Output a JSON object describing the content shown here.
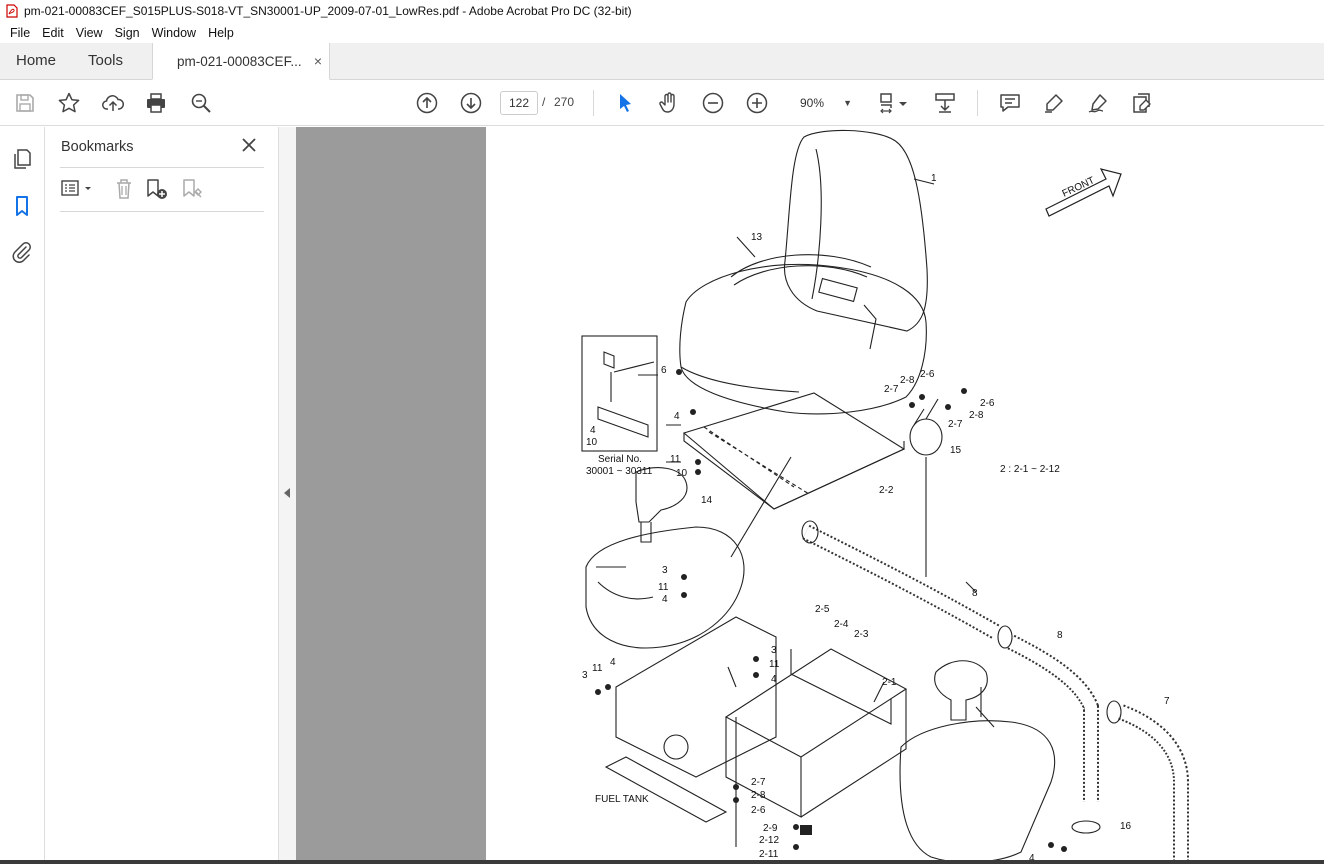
{
  "window": {
    "title": "pm-021-00083CEF_S015PLUS-S018-VT_SN30001-UP_2009-07-01_LowRes.pdf - Adobe Acrobat Pro DC (32-bit)"
  },
  "menu": [
    "File",
    "Edit",
    "View",
    "Sign",
    "Window",
    "Help"
  ],
  "tabs": {
    "home": "Home",
    "tools": "Tools",
    "document": "pm-021-00083CEF...",
    "close_glyph": "×"
  },
  "toolbar": {
    "current_page": "122",
    "page_separator": "/",
    "total_pages": "270",
    "zoom": "90%",
    "icons": [
      "save-icon",
      "star-icon",
      "upload-icon",
      "print-icon",
      "search-zoom-icon",
      "page-up-icon",
      "page-down-icon",
      "select-arrow-icon",
      "hand-icon",
      "zoom-out-icon",
      "zoom-in-icon",
      "fit-page-icon",
      "scroll-mode-icon",
      "comment-icon",
      "highlight-icon",
      "sign-icon",
      "edit-icon"
    ]
  },
  "sidebar": {
    "title": "Bookmarks",
    "close_glyph": "×",
    "rail_icons": [
      "pages-icon",
      "bookmark-icon",
      "attachment-icon"
    ],
    "tools": [
      "options-menu-icon",
      "delete-bookmark-icon",
      "new-bookmark-icon",
      "bookmark-properties-icon"
    ]
  },
  "drawing": {
    "front_label": "FRONT",
    "serial_label_1": "Serial No.",
    "serial_label_2": "30001 ~ 30311",
    "group_note": "2 : 2-1 ~ 2-12",
    "fuel_tank": "FUEL TANK",
    "callouts": [
      "1",
      "13",
      "6",
      "4",
      "10",
      "4",
      "10",
      "11",
      "2-8",
      "2-6",
      "2-7",
      "2-6",
      "2-7",
      "2-8",
      "15",
      "2-2",
      "14",
      "3",
      "11",
      "4",
      "2-5",
      "2-4",
      "2-3",
      "8",
      "8",
      "3",
      "11",
      "4",
      "3",
      "11",
      "4",
      "2-1",
      "7",
      "2-7",
      "2-8",
      "2-6",
      "2-9",
      "2-12",
      "2-11",
      "16",
      "4"
    ]
  }
}
